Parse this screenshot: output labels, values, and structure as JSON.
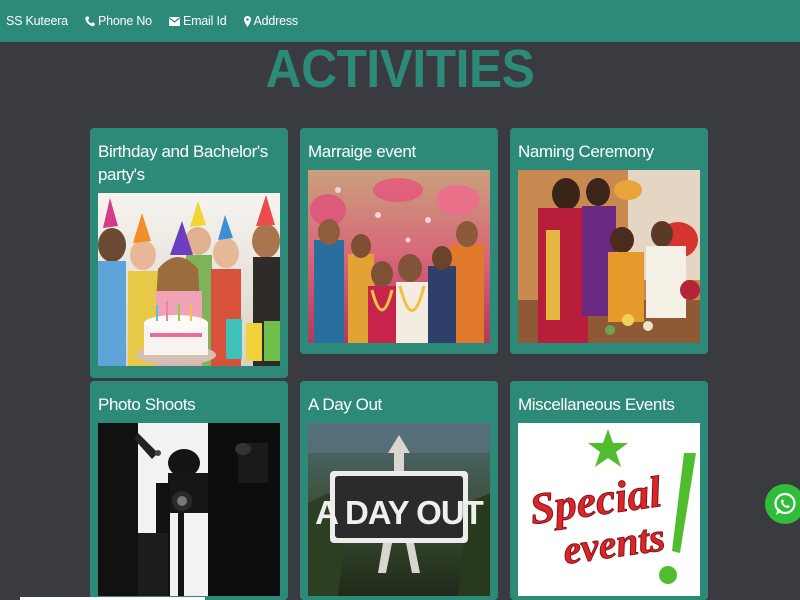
{
  "navbar": {
    "brand": "SS Kuteera",
    "phone_label": "Phone No",
    "email_label": "Email Id",
    "address_label": "Address"
  },
  "page": {
    "title": "ACTIVITIES"
  },
  "cards": [
    {
      "title": "Birthday and Bachelor's party's",
      "image": "birthday-party-photo"
    },
    {
      "title": "Marraige event",
      "image": "wedding-event-photo"
    },
    {
      "title": "Naming Ceremony",
      "image": "naming-ceremony-photo"
    },
    {
      "title": "Photo Shoots",
      "image": "photo-shoot-photo"
    },
    {
      "title": "A Day Out",
      "image": "a-day-out-graphic",
      "image_text": "A DAY OUT"
    },
    {
      "title": "Miscellaneous Events",
      "image": "special-events-graphic",
      "image_text_line1": "Special",
      "image_text_line2": "events"
    }
  ],
  "floating": {
    "icon": "whatsapp-icon"
  },
  "colors": {
    "accent": "#2d8a78",
    "background": "#3a3b40",
    "whatsapp": "#2fbd3a"
  }
}
